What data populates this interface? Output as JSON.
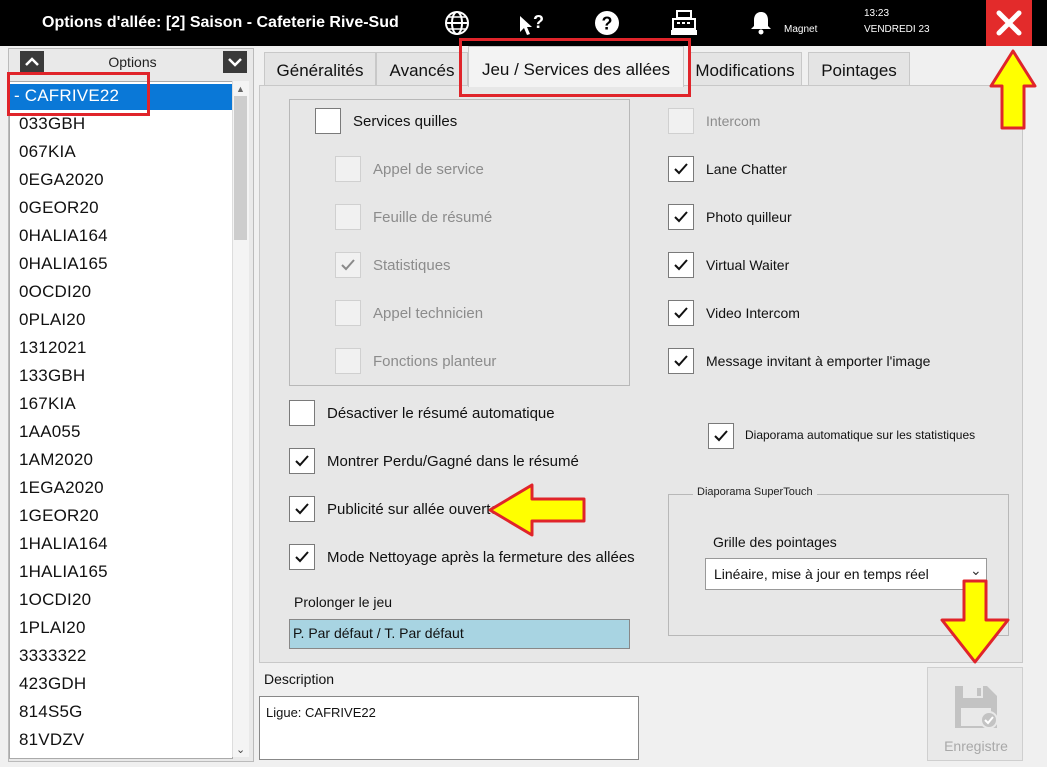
{
  "window": {
    "title": "Options d'allée: [2] Saison - Cafeterie Rive-Sud",
    "user": "Magnet",
    "time": "13:23",
    "date": "VENDREDI 23",
    "icons": [
      "globe-icon",
      "help-cursor-icon",
      "help-icon",
      "cash-register-icon",
      "bell-icon",
      "close-icon"
    ]
  },
  "sidebar": {
    "header": "Options",
    "items": [
      "- CAFRIVE22",
      "033GBH",
      "067KIA",
      "0EGA2020",
      "0GEOR20",
      "0HALIA164",
      "0HALIA165",
      "0OCDI20",
      "0PLAI20",
      "1312021",
      "133GBH",
      "167KIA",
      "1AA055",
      "1AM2020",
      "1EGA2020",
      "1GEOR20",
      "1HALIA164",
      "1HALIA165",
      "1OCDI20",
      "1PLAI20",
      "3333322",
      "423GDH",
      "814S5G",
      "81VDZV"
    ],
    "selected_index": 0
  },
  "tabs": [
    "Généralités",
    "Avancés",
    "Jeu / Services des allées",
    "Modifications",
    "Pointages"
  ],
  "active_tab": 2,
  "services_group": {
    "main": {
      "label": "Services quilles",
      "checked": false,
      "enabled": true
    },
    "items": [
      {
        "label": "Appel de service",
        "checked": false,
        "enabled": false
      },
      {
        "label": "Feuille de résumé",
        "checked": false,
        "enabled": false
      },
      {
        "label": "Statistiques",
        "checked": true,
        "enabled": false
      },
      {
        "label": "Appel technicien",
        "checked": false,
        "enabled": false
      },
      {
        "label": "Fonctions planteur",
        "checked": false,
        "enabled": false
      }
    ]
  },
  "left_options": [
    {
      "label": "Désactiver le résumé automatique",
      "checked": false
    },
    {
      "label": "Montrer Perdu/Gagné dans le résumé",
      "checked": true
    },
    {
      "label": "Publicité sur allée ouverte",
      "checked": true
    },
    {
      "label": "Mode Nettoyage après la fermeture des allées",
      "checked": true
    }
  ],
  "prolong": {
    "label": "Prolonger le jeu",
    "value": "P. Par défaut / T. Par défaut"
  },
  "right_options": [
    {
      "label": "Intercom",
      "checked": false,
      "enabled": false
    },
    {
      "label": "Lane Chatter",
      "checked": true,
      "enabled": true
    },
    {
      "label": "Photo quilleur",
      "checked": true,
      "enabled": true
    },
    {
      "label": "Virtual Waiter",
      "checked": true,
      "enabled": true
    },
    {
      "label": "Video Intercom",
      "checked": true,
      "enabled": true
    },
    {
      "label": "Message invitant à emporter l'image",
      "checked": true,
      "enabled": true
    }
  ],
  "diaporama_stats": {
    "label": "Diaporama automatique sur les statistiques",
    "checked": true
  },
  "supertouch": {
    "title": "Diaporama SuperTouch",
    "grid_label": "Grille des pointages",
    "grid_value": "Linéaire, mise à jour en temps réel"
  },
  "description": {
    "label": "Description",
    "value": "Ligue: CAFRIVE22"
  },
  "save_button": {
    "label": "Enregistre",
    "enabled": false
  },
  "colors": {
    "titlebar": "#000000",
    "close": "#e32b2b",
    "selection": "#0a78d7",
    "highlight_box": "#e0242a",
    "arrow": "#ffff00",
    "prolong_bg": "#a8d4e2"
  }
}
